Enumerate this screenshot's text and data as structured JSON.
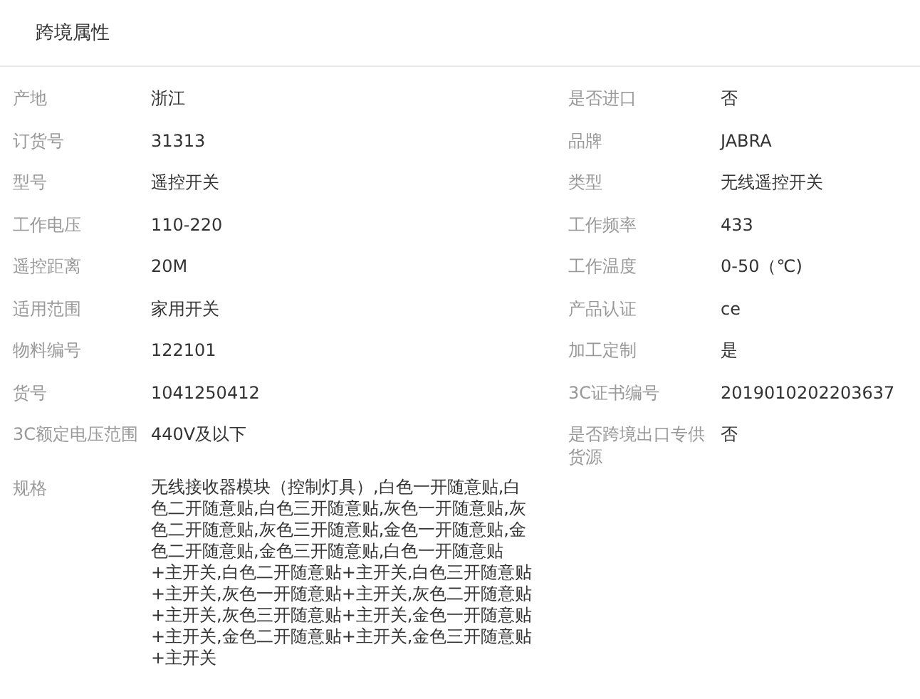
{
  "title": "跨境属性",
  "attributes": [
    {
      "label": "产地",
      "value": "浙江"
    },
    {
      "label": "是否进口",
      "value": "否"
    },
    {
      "label": "订货号",
      "value": "31313"
    },
    {
      "label": "品牌",
      "value": "JABRA"
    },
    {
      "label": "型号",
      "value": "遥控开关"
    },
    {
      "label": "类型",
      "value": "无线遥控开关"
    },
    {
      "label": "工作电压",
      "value": "110-220"
    },
    {
      "label": "工作频率",
      "value": "433"
    },
    {
      "label": "遥控距离",
      "value": "20M"
    },
    {
      "label": "工作温度",
      "value": "0-50（℃)"
    },
    {
      "label": "适用范围",
      "value": "家用开关"
    },
    {
      "label": "产品认证",
      "value": "ce"
    },
    {
      "label": "物料编号",
      "value": "122101"
    },
    {
      "label": "加工定制",
      "value": "是"
    },
    {
      "label": "货号",
      "value": "1041250412"
    },
    {
      "label": "3C证书编号",
      "value": "2019010202203637"
    },
    {
      "label": "3C额定电压范围",
      "value": "440V及以下"
    },
    {
      "label": "是否跨境出口专供货源",
      "value": "否"
    }
  ],
  "spec": {
    "label": "规格",
    "value": "无线接收器模块（控制灯具）,白色一开随意贴,白色二开随意贴,白色三开随意贴,灰色一开随意贴,灰色二开随意贴,灰色三开随意贴,金色一开随意贴,金色二开随意贴,金色三开随意贴,白色一开随意贴+主开关,白色二开随意贴+主开关,白色三开随意贴+主开关,灰色一开随意贴+主开关,灰色二开随意贴+主开关,灰色三开随意贴+主开关,金色一开随意贴+主开关,金色二开随意贴+主开关,金色三开随意贴+主开关"
  }
}
